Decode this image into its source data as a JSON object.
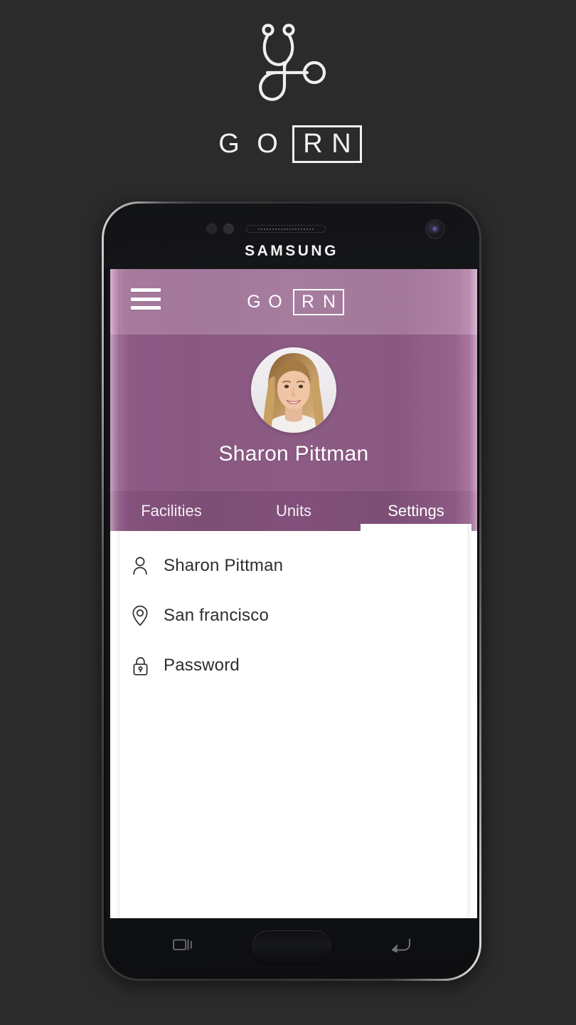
{
  "background_color": "#2b2b2b",
  "brand": {
    "logo_icon": "stethoscope-icon",
    "letters": [
      "G",
      "O"
    ],
    "boxed_letters": [
      "R",
      "N"
    ],
    "wordmark": "GORN"
  },
  "device": {
    "manufacturer": "SAMSUNG",
    "front_camera_icon": "front-camera-icon",
    "earpiece_icon": "earpiece-speaker-icon",
    "proximity_sensor_icon": "proximity-sensor-icon",
    "home_button_label": "home-button",
    "nav": {
      "recent_icon": "recent-apps-icon",
      "back_icon": "back-arrow-icon"
    }
  },
  "app": {
    "header": {
      "menu_icon": "hamburger-menu-icon",
      "letters": [
        "G",
        "O"
      ],
      "boxed_letters": [
        "R",
        "N"
      ],
      "title": "GORN",
      "background_color": "#a67d9e"
    },
    "profile": {
      "avatar_icon": "user-avatar-photo",
      "name": "Sharon Pittman",
      "background_color": "#8d5c85"
    },
    "tabs": [
      {
        "label": "Facilities",
        "active": false
      },
      {
        "label": "Units",
        "active": false
      },
      {
        "label": "Settings",
        "active": true
      }
    ],
    "settings_list": [
      {
        "icon": "person-icon",
        "label": "Sharon Pittman"
      },
      {
        "icon": "location-pin-icon",
        "label": "San francisco"
      },
      {
        "icon": "lock-icon",
        "label": "Password"
      }
    ]
  }
}
